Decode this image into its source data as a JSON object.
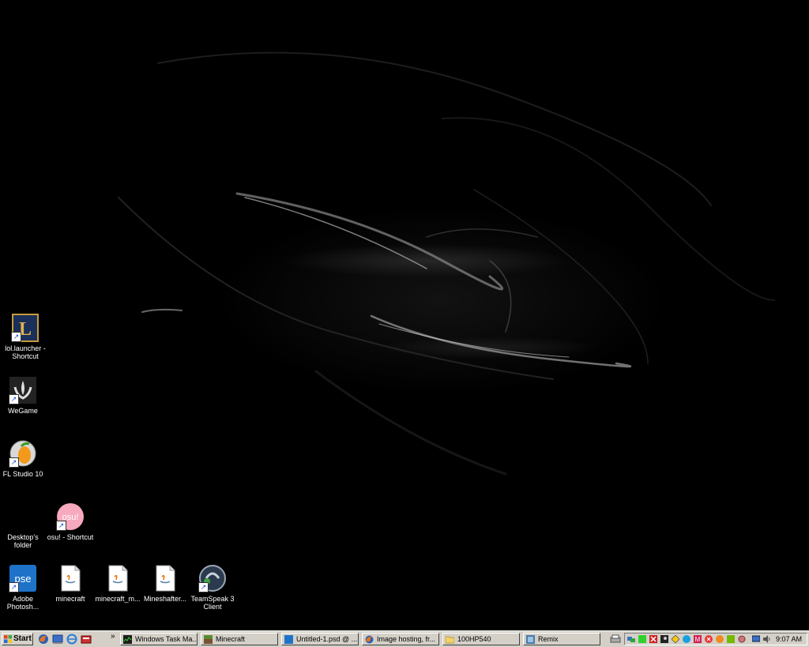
{
  "desktop": {
    "icons": [
      {
        "label": "lol.launcher - Shortcut",
        "icon": "league-of-legends-icon"
      },
      {
        "label": "WeGame",
        "icon": "wegame-icon"
      },
      {
        "label": "FL Studio 10",
        "icon": "fl-studio-icon"
      },
      {
        "label": "Desktop's folder",
        "icon": "folder-icon"
      },
      {
        "label": "osu! - Shortcut",
        "icon": "osu-icon",
        "badge": "osu!"
      },
      {
        "label": "Adobe Photosh...",
        "icon": "photoshop-elements-icon",
        "badge": "pse"
      },
      {
        "label": "minecraft",
        "icon": "java-file-icon"
      },
      {
        "label": "minecraft_m...",
        "icon": "java-file-icon"
      },
      {
        "label": "Mineshafter...",
        "icon": "java-file-icon"
      },
      {
        "label": "TeamSpeak 3 Client",
        "icon": "teamspeak-icon"
      }
    ]
  },
  "taskbar": {
    "start_label": "Start",
    "quicklaunch": [
      "firefox-icon",
      "show-desktop-icon",
      "internet-explorer-icon",
      "app-icon"
    ],
    "chevron": "»",
    "tasks": [
      {
        "label": "Windows Task Ma...",
        "icon": "task-manager-icon"
      },
      {
        "label": "Minecraft",
        "icon": "minecraft-icon"
      },
      {
        "label": "Untitled-1.psd @ ...",
        "icon": "photoshop-icon"
      },
      {
        "label": "Image hosting, fr...",
        "icon": "firefox-icon"
      },
      {
        "label": "100HP540",
        "icon": "folder-icon"
      },
      {
        "label": "Remix",
        "icon": "app-icon"
      }
    ],
    "tray_icons": [
      "network-icon",
      "green-app-icon",
      "x-app-icon",
      "steam-icon",
      "norton-icon",
      "skype-icon",
      "m-app-icon",
      "red-x-icon",
      "orange-app-icon",
      "nvidia-icon",
      "virus-icon",
      "display-icon",
      "volume-icon"
    ],
    "clock": "9:07 AM"
  },
  "colors": {
    "taskbar_bg": "#d4d0c8",
    "desktop_bg": "#000000"
  }
}
